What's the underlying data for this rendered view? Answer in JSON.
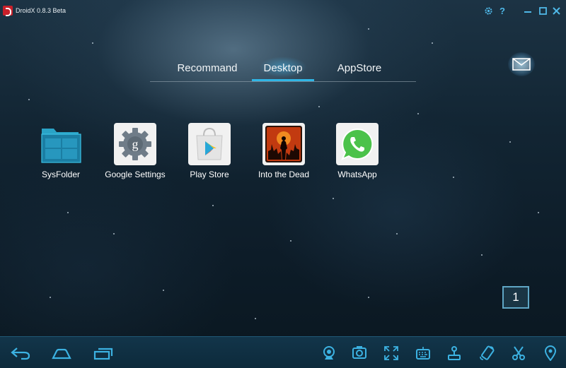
{
  "window": {
    "title": "DroidX 0.8.3 Beta",
    "icons": [
      "app-logo-icon",
      "gear-icon",
      "help-icon",
      "minimize-icon",
      "maximize-icon",
      "close-icon"
    ]
  },
  "tabs": [
    {
      "label": "Recommand",
      "active": false
    },
    {
      "label": "Desktop",
      "active": true
    },
    {
      "label": "AppStore",
      "active": false
    }
  ],
  "apps": [
    {
      "label": "SysFolder",
      "icon": "folder-icon"
    },
    {
      "label": "Google Settings",
      "icon": "google-settings-icon"
    },
    {
      "label": "Play Store",
      "icon": "play-store-icon"
    },
    {
      "label": "Into the Dead",
      "icon": "into-the-dead-icon"
    },
    {
      "label": "WhatsApp",
      "icon": "whatsapp-icon"
    }
  ],
  "page_indicator": "1",
  "bottom_bar": {
    "nav": [
      "back-icon",
      "home-icon",
      "recent-apps-icon"
    ],
    "tools": [
      "webcam-icon",
      "screenshot-icon",
      "fullscreen-icon",
      "keyboard-icon",
      "joystick-icon",
      "rotate-icon",
      "scissors-icon",
      "location-icon"
    ]
  },
  "colors": {
    "accent": "#2fb6e6",
    "bottom_bar": "#0f2f42",
    "titlebar_icons": "#4fb8e8"
  }
}
